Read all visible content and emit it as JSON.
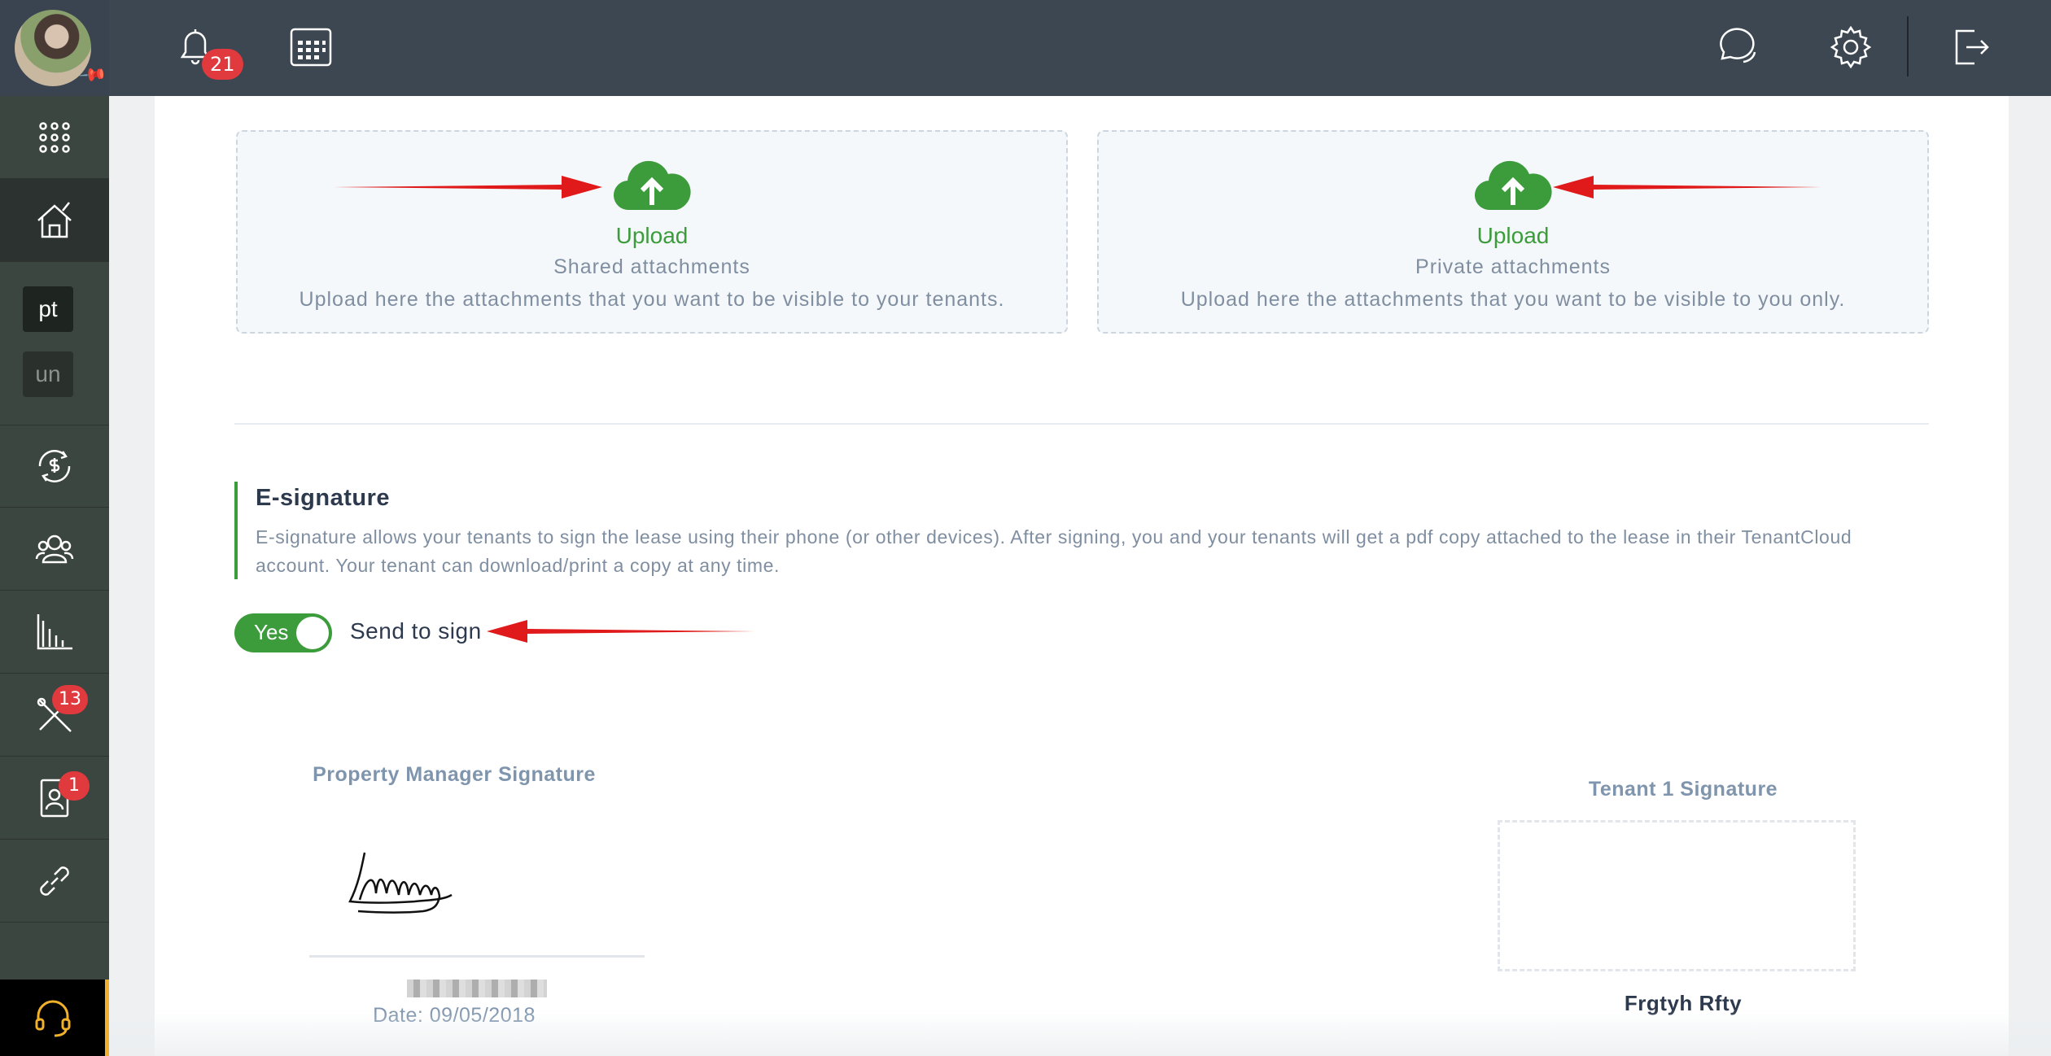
{
  "topbar": {
    "notifications_count": "21"
  },
  "sidebar": {
    "tile_1": "pt",
    "tile_2": "un",
    "maintenance_count": "13",
    "leases_count": "1"
  },
  "attachments": {
    "shared": {
      "label": "Upload",
      "title": "Shared attachments",
      "description": "Upload here the attachments that you want to be visible to your tenants."
    },
    "private": {
      "label": "Upload",
      "title": "Private attachments",
      "description": "Upload here the attachments that you want to be visible to you only."
    }
  },
  "esignature": {
    "heading": "E-signature",
    "description": "E-signature allows your tenants to sign the lease using their phone (or other devices). After signing, you and your tenants will get a pdf copy attached to the lease in their TenantCloud account. Your tenant can download/print a copy at any time.",
    "toggle_label": "Yes",
    "toggle_on": true,
    "send_label": "Send to sign"
  },
  "signatures": {
    "manager_title": "Property Manager Signature",
    "manager_date": "Date: 09/05/2018",
    "tenant_title": "Tenant 1 Signature",
    "tenant_name": "Frgtyh Rfty"
  },
  "colors": {
    "accent_green": "#3c9c3c",
    "badge_red": "#e0393e",
    "annotation_arrow": "#e01a1a"
  }
}
